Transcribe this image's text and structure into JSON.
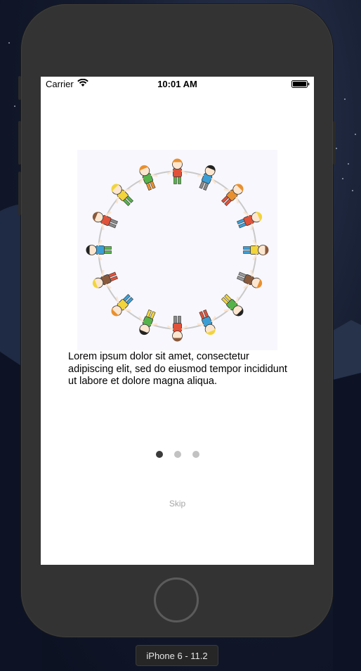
{
  "status_bar": {
    "carrier": "Carrier",
    "time": "10:01 AM",
    "wifi_icon": "wifi-icon",
    "battery_icon": "battery-icon"
  },
  "onboarding": {
    "image": "children-holding-hands-circle",
    "text": "Lorem ipsum dolor sit amet, consectetur adipiscing elit, sed do eiusmod tempor incididunt ut labore et dolore magna aliqua.",
    "page_count": 3,
    "current_page": 1,
    "skip_label": "Skip"
  },
  "simulator": {
    "device_label": "iPhone 6 - 11.2"
  }
}
